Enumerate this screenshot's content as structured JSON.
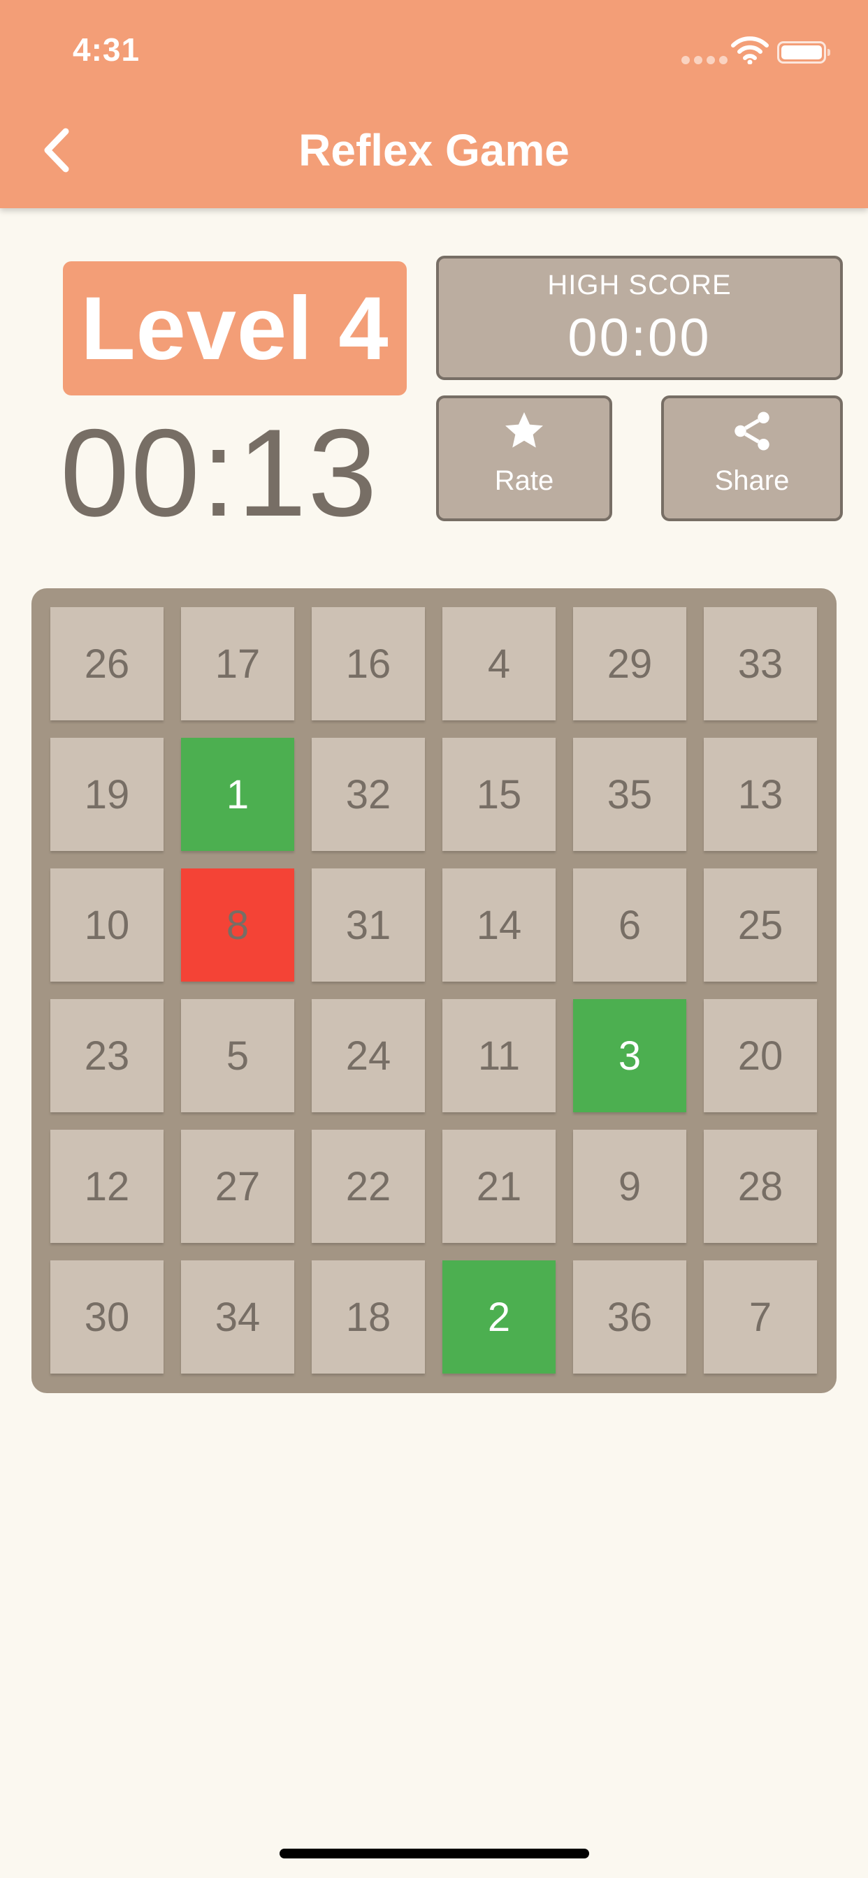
{
  "status_bar": {
    "time": "4:31",
    "icons": [
      "signal-dots-icon",
      "wifi-icon",
      "battery-icon"
    ]
  },
  "nav": {
    "back_icon": "chevron-left-icon",
    "title": "Reflex Game"
  },
  "game": {
    "level_label": "Level 4",
    "timer": "00:13",
    "high_score_label": "HIGH SCORE",
    "high_score_value": "00:00",
    "rate": {
      "icon": "star-icon",
      "label": "Rate"
    },
    "share": {
      "icon": "share-icon",
      "label": "Share"
    }
  },
  "board": {
    "rows": 6,
    "columns": 6,
    "tiles": [
      {
        "value": "26",
        "state": "normal"
      },
      {
        "value": "17",
        "state": "normal"
      },
      {
        "value": "16",
        "state": "normal"
      },
      {
        "value": "4",
        "state": "normal"
      },
      {
        "value": "29",
        "state": "normal"
      },
      {
        "value": "33",
        "state": "normal"
      },
      {
        "value": "19",
        "state": "normal"
      },
      {
        "value": "1",
        "state": "found"
      },
      {
        "value": "32",
        "state": "normal"
      },
      {
        "value": "15",
        "state": "normal"
      },
      {
        "value": "35",
        "state": "normal"
      },
      {
        "value": "13",
        "state": "normal"
      },
      {
        "value": "10",
        "state": "normal"
      },
      {
        "value": "8",
        "state": "wrong"
      },
      {
        "value": "31",
        "state": "normal"
      },
      {
        "value": "14",
        "state": "normal"
      },
      {
        "value": "6",
        "state": "normal"
      },
      {
        "value": "25",
        "state": "normal"
      },
      {
        "value": "23",
        "state": "normal"
      },
      {
        "value": "5",
        "state": "normal"
      },
      {
        "value": "24",
        "state": "normal"
      },
      {
        "value": "11",
        "state": "normal"
      },
      {
        "value": "3",
        "state": "found"
      },
      {
        "value": "20",
        "state": "normal"
      },
      {
        "value": "12",
        "state": "normal"
      },
      {
        "value": "27",
        "state": "normal"
      },
      {
        "value": "22",
        "state": "normal"
      },
      {
        "value": "21",
        "state": "normal"
      },
      {
        "value": "9",
        "state": "normal"
      },
      {
        "value": "28",
        "state": "normal"
      },
      {
        "value": "30",
        "state": "normal"
      },
      {
        "value": "34",
        "state": "normal"
      },
      {
        "value": "18",
        "state": "normal"
      },
      {
        "value": "2",
        "state": "found"
      },
      {
        "value": "36",
        "state": "normal"
      },
      {
        "value": "7",
        "state": "normal"
      }
    ]
  },
  "colors": {
    "accent": "#f39e77",
    "background": "#fbf8f0",
    "board": "#a39584",
    "tile": "#cdc1b4",
    "tile_text": "#776e65",
    "found": "#4caf50",
    "wrong": "#f44336",
    "panel": "#bbada0"
  }
}
